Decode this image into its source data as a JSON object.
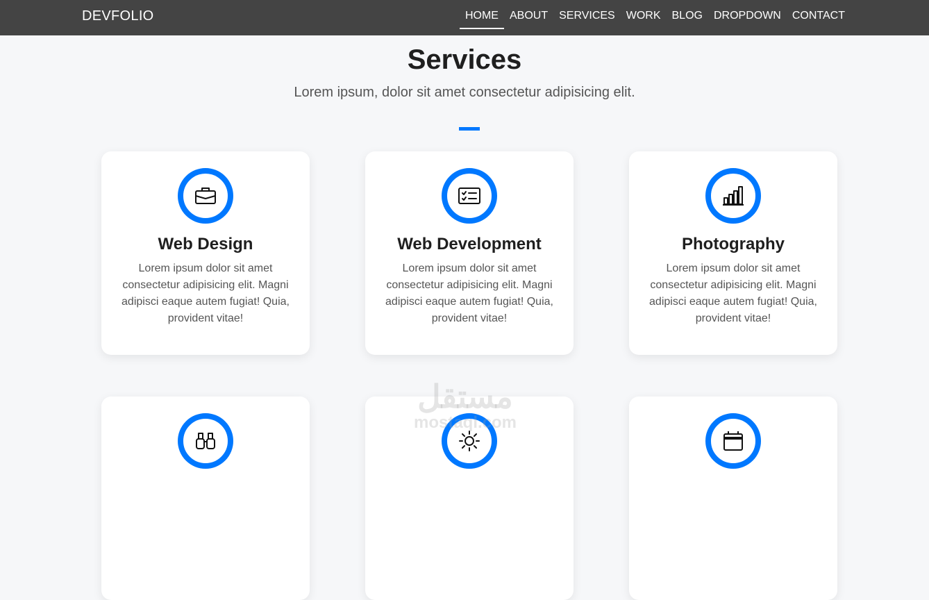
{
  "brand": "DEVFOLIO",
  "nav": [
    "HOME",
    "ABOUT",
    "SERVICES",
    "WORK",
    "BLOG",
    "DROPDOWN",
    "CONTACT"
  ],
  "section": {
    "title": "Services",
    "subtitle": "Lorem ipsum, dolor sit amet consectetur adipisicing elit."
  },
  "cards": [
    {
      "title": "Web Design",
      "text": "Lorem ipsum dolor sit amet consectetur adipisicing elit. Magni adipisci eaque autem fugiat! Quia, provident vitae!",
      "icon": "briefcase-icon"
    },
    {
      "title": "Web Development",
      "text": "Lorem ipsum dolor sit amet consectetur adipisicing elit. Magni adipisci eaque autem fugiat! Quia, provident vitae!",
      "icon": "card-checklist-icon"
    },
    {
      "title": "Photography",
      "text": "Lorem ipsum dolor sit amet consectetur adipisicing elit. Magni adipisci eaque autem fugiat! Quia, provident vitae!",
      "icon": "bar-chart-icon"
    },
    {
      "title": "",
      "text": "",
      "icon": "binoculars-icon"
    },
    {
      "title": "",
      "text": "",
      "icon": "sun-icon"
    },
    {
      "title": "",
      "text": "",
      "icon": "calendar-icon"
    }
  ],
  "watermark": {
    "arabic": "مستقل",
    "latin": "mostaql.com"
  },
  "colors": {
    "accent": "#0078ff",
    "navbar": "#444444",
    "background": "#f6f7f9"
  }
}
